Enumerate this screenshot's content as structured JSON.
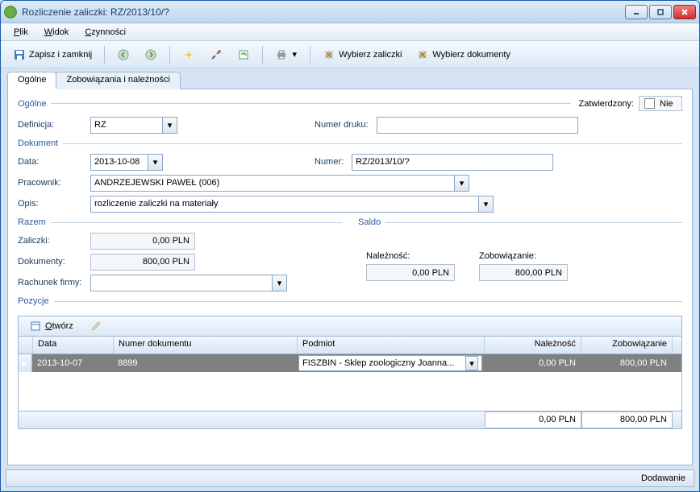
{
  "window": {
    "title": "Rozliczenie zaliczki: RZ/2013/10/?"
  },
  "menu": {
    "plik": "Plik",
    "widok": "Widok",
    "czynnosci": "Czynności"
  },
  "toolbar": {
    "save_close": "Zapisz i zamknij",
    "wybierz_zaliczki": "Wybierz zaliczki",
    "wybierz_dokumenty": "Wybierz dokumenty"
  },
  "tabs": {
    "ogolne": "Ogólne",
    "zobo": "Zobowiązania i należności"
  },
  "approved": {
    "label": "Zatwierdzony:",
    "value": "Nie"
  },
  "ogolne": {
    "section": "Ogólne",
    "definicja_label": "Definicja:",
    "definicja_value": "RZ",
    "numer_druku_label": "Numer druku:",
    "numer_druku_value": ""
  },
  "dokument": {
    "section": "Dokument",
    "data_label": "Data:",
    "data_value": "2013-10-08",
    "numer_label": "Numer:",
    "numer_value": "RZ/2013/10/?",
    "pracownik_label": "Pracownik:",
    "pracownik_value": "ANDRZEJEWSKI PAWEŁ (006)",
    "opis_label": "Opis:",
    "opis_value": "rozliczenie zaliczki na materiały"
  },
  "razem": {
    "section": "Razem",
    "zaliczki_label": "Zaliczki:",
    "zaliczki_value": "0,00 PLN",
    "dokumenty_label": "Dokumenty:",
    "dokumenty_value": "800,00 PLN",
    "rachunek_label": "Rachunek firmy:",
    "rachunek_value": ""
  },
  "saldo": {
    "section": "Saldo",
    "naleznosc_label": "Należność:",
    "naleznosc_value": "0,00 PLN",
    "zobowiazanie_label": "Zobowiązanie:",
    "zobowiazanie_value": "800,00 PLN"
  },
  "pozycje": {
    "section": "Pozycje",
    "otworz": "Otwórz"
  },
  "grid": {
    "headers": {
      "data": "Data",
      "numer": "Numer dokumentu",
      "podmiot": "Podmiot",
      "naleznosc": "Należność",
      "zobowiazanie": "Zobowiązanie"
    },
    "rows": [
      {
        "data": "2013-10-07",
        "numer": "8899",
        "podmiot": "FISZBIN - Sklep zoologiczny  Joanna...",
        "naleznosc": "0,00 PLN",
        "zobowiazanie": "800,00 PLN"
      }
    ],
    "footer": {
      "naleznosc": "0,00 PLN",
      "zobowiazanie": "800,00 PLN"
    }
  },
  "statusbar": {
    "mode": "Dodawanie"
  }
}
